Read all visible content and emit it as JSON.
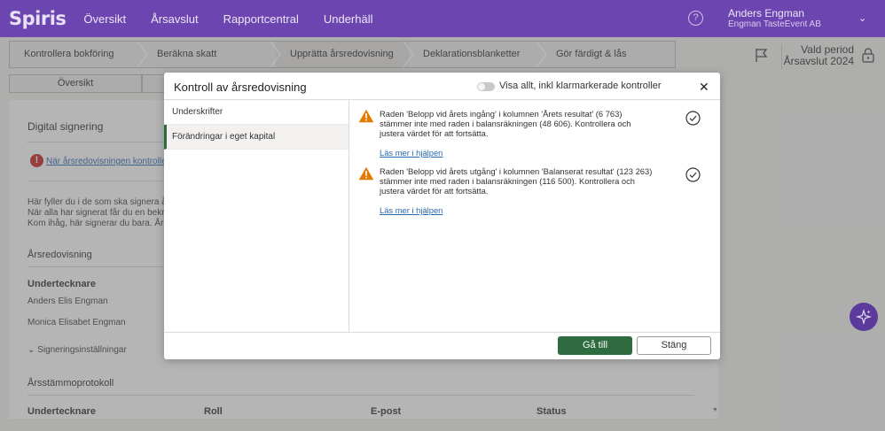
{
  "app": {
    "logo": "Spiris"
  },
  "nav": {
    "items": [
      {
        "label": "Översikt"
      },
      {
        "label": "Årsavslut"
      },
      {
        "label": "Rapportcentral"
      },
      {
        "label": "Underhäll"
      }
    ]
  },
  "user": {
    "name": "Anders Engman",
    "company": "Engman TasteEvent AB"
  },
  "stepper": {
    "steps": [
      {
        "label": "Kontrollera bokföring"
      },
      {
        "label": "Beräkna skatt"
      },
      {
        "label": "Upprätta årsredovisning"
      },
      {
        "label": "Deklarationsblanketter"
      },
      {
        "label": "Gör färdigt & lås"
      }
    ]
  },
  "period": {
    "label": "Vald period",
    "value": "Årsavslut 2024"
  },
  "subtabs": {
    "first": "Översikt"
  },
  "background": {
    "section_title": "Digital signering",
    "alert_link": "När årsredovisningen kontrollerad",
    "para1": "Här fyller du i de som ska signera års",
    "para2": "När alla har signerat får du en bekrä",
    "para3": "Kom ihåg, här signerar du bara. Årsr",
    "arsredovisning": "Årsredovisning",
    "undertecknare": "Undertecknare",
    "signer1": "Anders Elis Engman",
    "signer2": "Monica Elisabet Engman",
    "settings": "Signeringsinställningar",
    "protokoll": "Årsstämmoprotokoll",
    "table_headers": [
      "Undertecknare",
      "Roll",
      "E-post",
      "Status"
    ]
  },
  "modal": {
    "title": "Kontroll av årsredovisning",
    "toggle_label": "Visa allt, inkl klarmarkerade kontroller",
    "sidebar": [
      {
        "label": "Underskrifter"
      },
      {
        "label": "Förändringar i eget kapital"
      }
    ],
    "issues": [
      {
        "text": "Raden 'Belopp vid årets ingång' i kolumnen 'Årets resultat' (6 763) stämmer inte med raden i balansräkningen (48 606). Kontrollera och justera värdet för att fortsätta.",
        "link": "Läs mer i hjälpen"
      },
      {
        "text": "Raden 'Belopp vid årets utgång' i kolumnen 'Balanserat resultat' (123 263) stämmer inte med raden i balansräkningen (116 500). Kontrollera och justera värdet för att fortsätta.",
        "link": "Läs mer i hjälpen"
      }
    ],
    "primary_button": "Gå till",
    "secondary_button": "Stäng"
  },
  "colors": {
    "brand": "#6c45b0",
    "primary": "#2e6b3f",
    "link": "#2a6ab0",
    "warning": "#e07b00",
    "error": "#c62828"
  }
}
